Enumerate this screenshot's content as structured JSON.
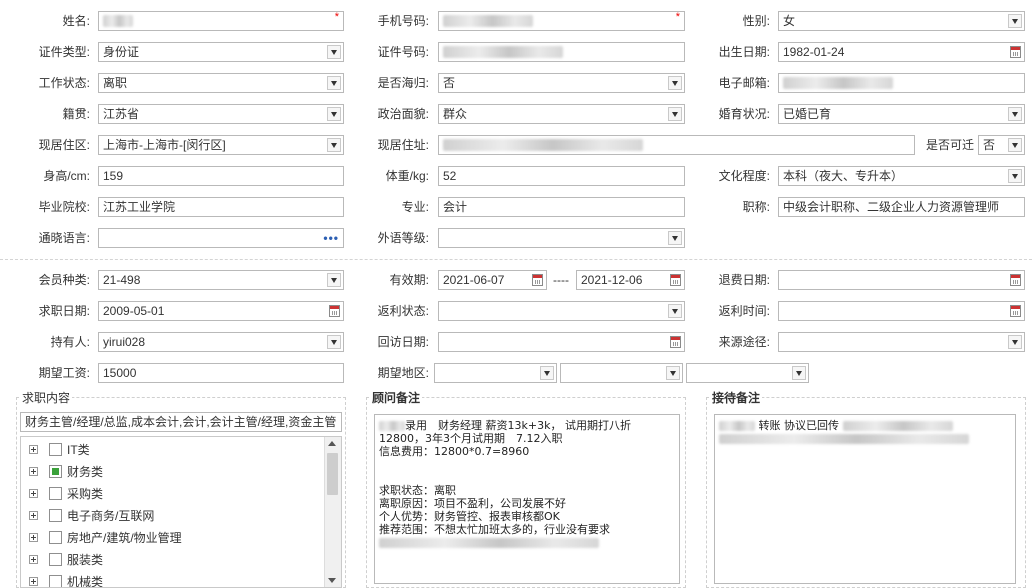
{
  "personal": {
    "name_label": "姓名:",
    "mobile_label": "手机号码:",
    "gender_label": "性别:",
    "gender_value": "女",
    "id_type_label": "证件类型:",
    "id_type_value": "身份证",
    "id_no_label": "证件号码:",
    "birth_label": "出生日期:",
    "birth_value": "1982-01-24",
    "work_status_label": "工作状态:",
    "work_status_value": "离职",
    "overseas_label": "是否海归:",
    "overseas_value": "否",
    "email_label": "电子邮箱:",
    "native_label": "籍贯:",
    "native_value": "江苏省",
    "political_label": "政治面貌:",
    "political_value": "群众",
    "marital_label": "婚育状况:",
    "marital_value": "已婚已育",
    "residence_area_label": "现居住区:",
    "residence_area_value": "上海市-上海市-[闵行区]",
    "residence_addr_label": "现居住址:",
    "overtime_label": "是否可迁",
    "overtime_value": "否",
    "height_label": "身高/cm:",
    "height_value": "159",
    "weight_label": "体重/kg:",
    "weight_value": "52",
    "education_label": "文化程度:",
    "education_value": "本科（夜大、专升本）",
    "school_label": "毕业院校:",
    "school_value": "江苏工业学院",
    "major_label": "专业:",
    "major_value": "会计",
    "title_label": "职称:",
    "title_value": "中级会计职称、二级企业人力资源管理师",
    "language_label": "通晓语言:",
    "language_dots": "•••",
    "foreign_level_label": "外语等级:"
  },
  "member": {
    "type_label": "会员种类:",
    "type_value": "21-498",
    "valid_label": "有效期:",
    "valid_from": "2021-06-07",
    "valid_sep": "----",
    "valid_to": "2021-12-06",
    "refund_date_label": "退费日期:",
    "job_date_label": "求职日期:",
    "job_date_value": "2009-05-01",
    "rebate_status_label": "返利状态:",
    "rebate_time_label": "返利时间:",
    "holder_label": "持有人:",
    "holder_value": "yirui028",
    "visit_date_label": "回访日期:",
    "source_label": "来源途径:",
    "salary_label": "期望工资:",
    "salary_value": "15000",
    "region_label": "期望地区:"
  },
  "job_content": {
    "title": "求职内容",
    "summary": "财务主管/经理/总监,成本会计,会计,会计主管/经理,资金主管",
    "tree": [
      {
        "label": "IT类",
        "checked": false
      },
      {
        "label": "财务类",
        "checked": true
      },
      {
        "label": "采购类",
        "checked": false
      },
      {
        "label": "电子商务/互联网",
        "checked": false
      },
      {
        "label": "房地产/建筑/物业管理",
        "checked": false
      },
      {
        "label": "服装类",
        "checked": false
      },
      {
        "label": "机械类",
        "checked": false
      }
    ]
  },
  "consultant_notes": {
    "title": "顾问备注",
    "lines": [
      "录用　财务经理 薪资13k+3k， 试用期打八折",
      "12800，3年3个月试用期　7.12入职",
      "信息费用：12800*0.7=8960",
      "",
      "",
      "求职状态：离职",
      "离职原因：项目不盈利，公司发展不好",
      "个人优势：财务管控、报表审核都OK",
      "推荐范围：不想太忙加班太多的，行业没有要求"
    ]
  },
  "reception_notes": {
    "title": "接待备注",
    "line1": "转账 协议已回传"
  },
  "required_mark": "*"
}
